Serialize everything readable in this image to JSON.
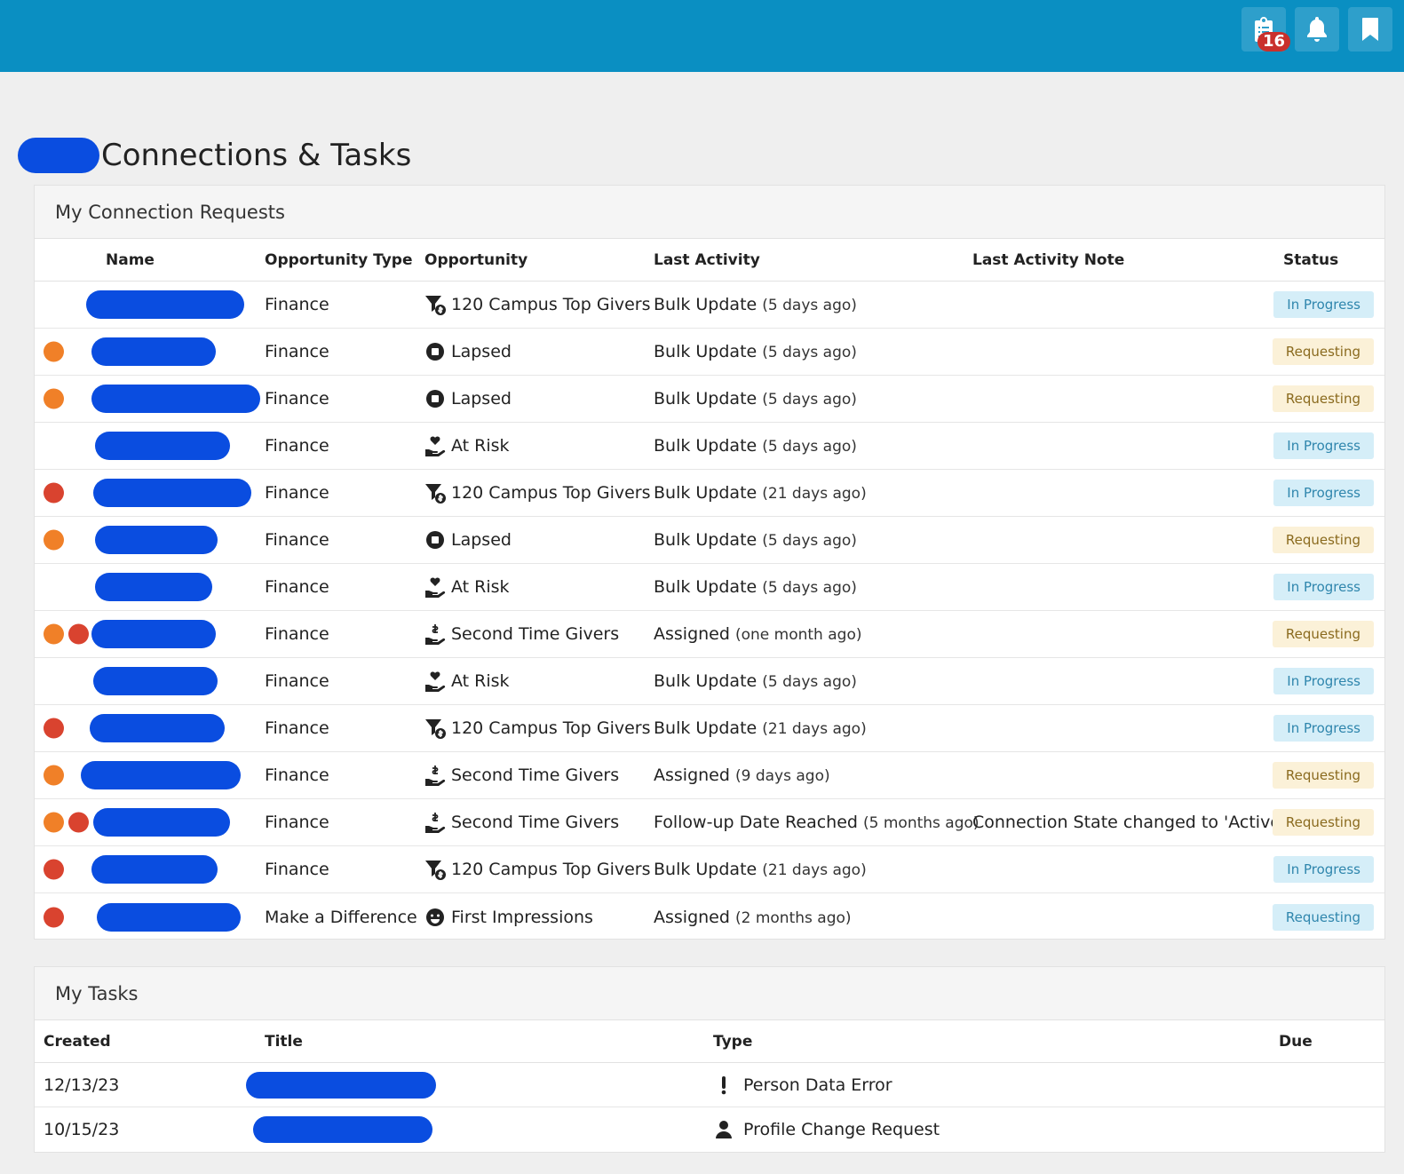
{
  "topbar": {
    "tasks_badge": "16",
    "icons": [
      "clipboard-list-icon",
      "bell-icon",
      "bookmark-icon"
    ],
    "color": "#0a8fc2"
  },
  "page": {
    "title": "Connections & Tasks"
  },
  "connections": {
    "heading": "My Connection Requests",
    "columns": {
      "name": "Name",
      "opportunity_type": "Opportunity Type",
      "opportunity": "Opportunity",
      "last_activity": "Last Activity",
      "last_activity_note": "Last Activity Note",
      "status": "Status"
    },
    "rows": [
      {
        "dots": [],
        "type": "Finance",
        "icon": "funnel-dollar-icon",
        "opp": "120 Campus Top Givers",
        "activity": "Bulk Update",
        "when": "(5 days ago)",
        "note": "",
        "status": "In Progress",
        "status_style": "prog"
      },
      {
        "dots": [
          "orange"
        ],
        "type": "Finance",
        "icon": "stop-circle-icon",
        "opp": "Lapsed",
        "activity": "Bulk Update",
        "when": "(5 days ago)",
        "note": "",
        "status": "Requesting",
        "status_style": "req"
      },
      {
        "dots": [
          "orange"
        ],
        "type": "Finance",
        "icon": "stop-circle-icon",
        "opp": "Lapsed",
        "activity": "Bulk Update",
        "when": "(5 days ago)",
        "note": "",
        "status": "Requesting",
        "status_style": "req"
      },
      {
        "dots": [],
        "type": "Finance",
        "icon": "hand-holding-heart-icon",
        "opp": "At Risk",
        "activity": "Bulk Update",
        "when": "(5 days ago)",
        "note": "",
        "status": "In Progress",
        "status_style": "prog"
      },
      {
        "dots": [
          "red"
        ],
        "type": "Finance",
        "icon": "funnel-dollar-icon",
        "opp": "120 Campus Top Givers",
        "activity": "Bulk Update",
        "when": "(21 days ago)",
        "note": "",
        "status": "In Progress",
        "status_style": "prog"
      },
      {
        "dots": [
          "orange"
        ],
        "type": "Finance",
        "icon": "stop-circle-icon",
        "opp": "Lapsed",
        "activity": "Bulk Update",
        "when": "(5 days ago)",
        "note": "",
        "status": "Requesting",
        "status_style": "req"
      },
      {
        "dots": [],
        "type": "Finance",
        "icon": "hand-holding-heart-icon",
        "opp": "At Risk",
        "activity": "Bulk Update",
        "when": "(5 days ago)",
        "note": "",
        "status": "In Progress",
        "status_style": "prog"
      },
      {
        "dots": [
          "orange",
          "red"
        ],
        "type": "Finance",
        "icon": "hand-holding-dollar-icon",
        "opp": "Second Time Givers",
        "activity": "Assigned",
        "when": "(one month ago)",
        "note": "",
        "status": "Requesting",
        "status_style": "req"
      },
      {
        "dots": [],
        "type": "Finance",
        "icon": "hand-holding-heart-icon",
        "opp": "At Risk",
        "activity": "Bulk Update",
        "when": "(5 days ago)",
        "note": "",
        "status": "In Progress",
        "status_style": "prog"
      },
      {
        "dots": [
          "red"
        ],
        "type": "Finance",
        "icon": "funnel-dollar-icon",
        "opp": "120 Campus Top Givers",
        "activity": "Bulk Update",
        "when": "(21 days ago)",
        "note": "",
        "status": "In Progress",
        "status_style": "prog"
      },
      {
        "dots": [
          "orange"
        ],
        "type": "Finance",
        "icon": "hand-holding-dollar-icon",
        "opp": "Second Time Givers",
        "activity": "Assigned",
        "when": "(9 days ago)",
        "note": "",
        "status": "Requesting",
        "status_style": "req"
      },
      {
        "dots": [
          "orange",
          "red"
        ],
        "type": "Finance",
        "icon": "hand-holding-dollar-icon",
        "opp": "Second Time Givers",
        "activity": "Follow-up Date Reached",
        "when": "(5 months ago)",
        "note": "Connection State changed to 'Active'.",
        "status": "Requesting",
        "status_style": "req"
      },
      {
        "dots": [
          "red"
        ],
        "type": "Finance",
        "icon": "funnel-dollar-icon",
        "opp": "120 Campus Top Givers",
        "activity": "Bulk Update",
        "when": "(21 days ago)",
        "note": "",
        "status": "In Progress",
        "status_style": "prog"
      },
      {
        "dots": [
          "red"
        ],
        "type": "Make a Difference",
        "icon": "smile-icon",
        "opp": "First Impressions",
        "activity": "Assigned",
        "when": "(2 months ago)",
        "note": "",
        "status": "Requesting",
        "status_style": "req-blue"
      }
    ],
    "colors": {
      "orange": "#f08028",
      "red": "#d9432f"
    }
  },
  "tasks": {
    "heading": "My Tasks",
    "columns": {
      "created": "Created",
      "title": "Title",
      "type": "Type",
      "due": "Due"
    },
    "rows": [
      {
        "created": "12/13/23",
        "icon": "exclamation-icon",
        "type": "Person Data Error",
        "due": ""
      },
      {
        "created": "10/15/23",
        "icon": "user-icon",
        "type": "Profile Change Request",
        "due": ""
      }
    ]
  }
}
